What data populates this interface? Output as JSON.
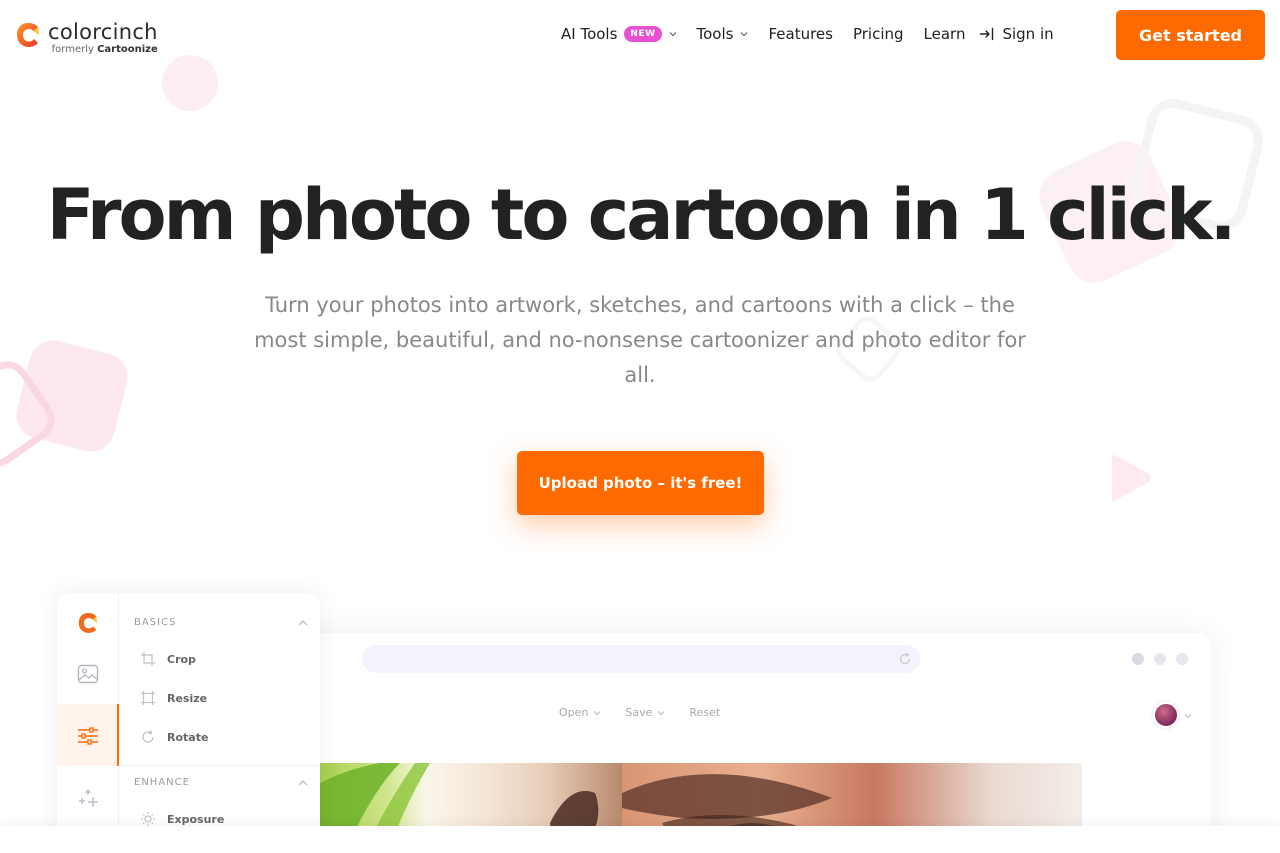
{
  "brand": {
    "name": "colorcinch",
    "formerly_prefix": "formerly",
    "formerly_name": "Cartoonize",
    "accent_color": "#ff6a00",
    "badge_color": "#e84fd1"
  },
  "nav": {
    "ai_tools": "AI Tools",
    "new_badge": "NEW",
    "tools": "Tools",
    "features": "Features",
    "pricing": "Pricing",
    "learn": "Learn",
    "sign_in": "Sign in",
    "get_started": "Get started"
  },
  "hero": {
    "title": "From photo to cartoon in 1 click.",
    "subtitle": "Turn your photos into artwork, sketches, and cartoons with a click – the most simple, beautiful, and no-nonsense cartoonizer and photo editor for all.",
    "cta": "Upload photo – it's free!"
  },
  "mockup": {
    "toolbar": {
      "open": "Open",
      "save": "Save",
      "reset": "Reset"
    },
    "panel": {
      "basics_heading": "BASICS",
      "crop": "Crop",
      "resize": "Resize",
      "rotate": "Rotate",
      "enhance_heading": "ENHANCE",
      "exposure": "Exposure"
    },
    "icons": [
      "logo-icon",
      "image-icon",
      "sliders-icon",
      "sparkle-icon",
      "crop-icon",
      "resize-icon",
      "rotate-icon",
      "sun-icon"
    ]
  }
}
